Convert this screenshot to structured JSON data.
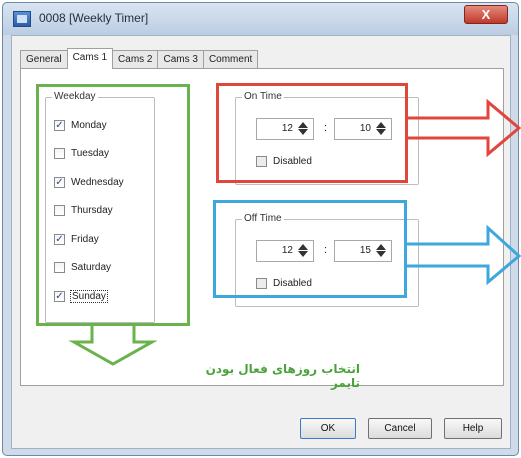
{
  "window": {
    "title": "0008 [Weekly Timer]",
    "close_label": "X"
  },
  "tabs": [
    {
      "label": "General",
      "active": false
    },
    {
      "label": "Cams 1",
      "active": true
    },
    {
      "label": "Cams 2",
      "active": false
    },
    {
      "label": "Cams 3",
      "active": false
    },
    {
      "label": "Comment",
      "active": false
    }
  ],
  "weekday": {
    "legend": "Weekday",
    "days": [
      {
        "label": "Monday",
        "checked": true
      },
      {
        "label": "Tuesday",
        "checked": false
      },
      {
        "label": "Wednesday",
        "checked": true
      },
      {
        "label": "Thursday",
        "checked": false
      },
      {
        "label": "Friday",
        "checked": true
      },
      {
        "label": "Saturday",
        "checked": false
      },
      {
        "label": "Sunday",
        "checked": true
      }
    ]
  },
  "on_time": {
    "legend": "On Time",
    "hour": "12",
    "minute": "10",
    "separator": ":",
    "disabled_label": "Disabled"
  },
  "off_time": {
    "legend": "Off Time",
    "hour": "12",
    "minute": "15",
    "separator": ":",
    "disabled_label": "Disabled"
  },
  "buttons": {
    "ok": "OK",
    "cancel": "Cancel",
    "help": "Help"
  },
  "annotation": {
    "text": "انتخاب روزهای فعال بودن تایمر"
  },
  "colors": {
    "annotation_green": "#6ab24e",
    "annotation_red": "#e0473c",
    "annotation_blue": "#3ea7dd"
  }
}
